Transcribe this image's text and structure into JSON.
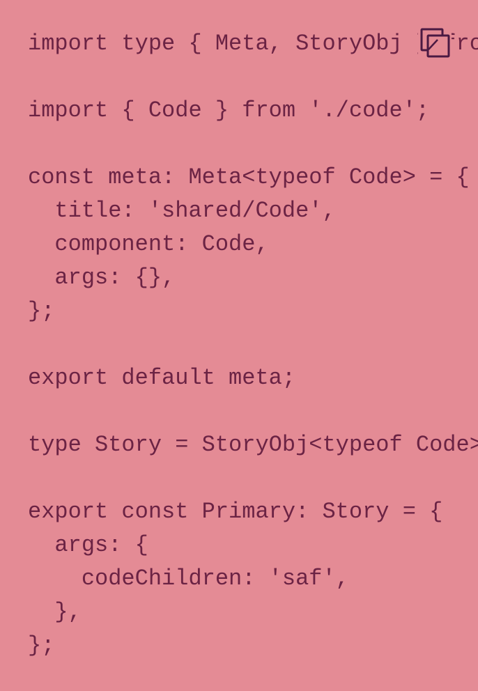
{
  "colors": {
    "background": "#E48B95",
    "code_text": "#6B2344",
    "icon_stroke": "#4A1942"
  },
  "copy_button": {
    "icon": "copy-icon"
  },
  "code_lines": [
    "import type { Meta, StoryObj } from",
    "",
    "import { Code } from './code';",
    "",
    "const meta: Meta<typeof Code> = {",
    "  title: 'shared/Code',",
    "  component: Code,",
    "  args: {},",
    "};",
    "",
    "export default meta;",
    "",
    "type Story = StoryObj<typeof Code>",
    "",
    "export const Primary: Story = {",
    "  args: {",
    "    codeChildren: 'saf',",
    "  },",
    "};"
  ]
}
